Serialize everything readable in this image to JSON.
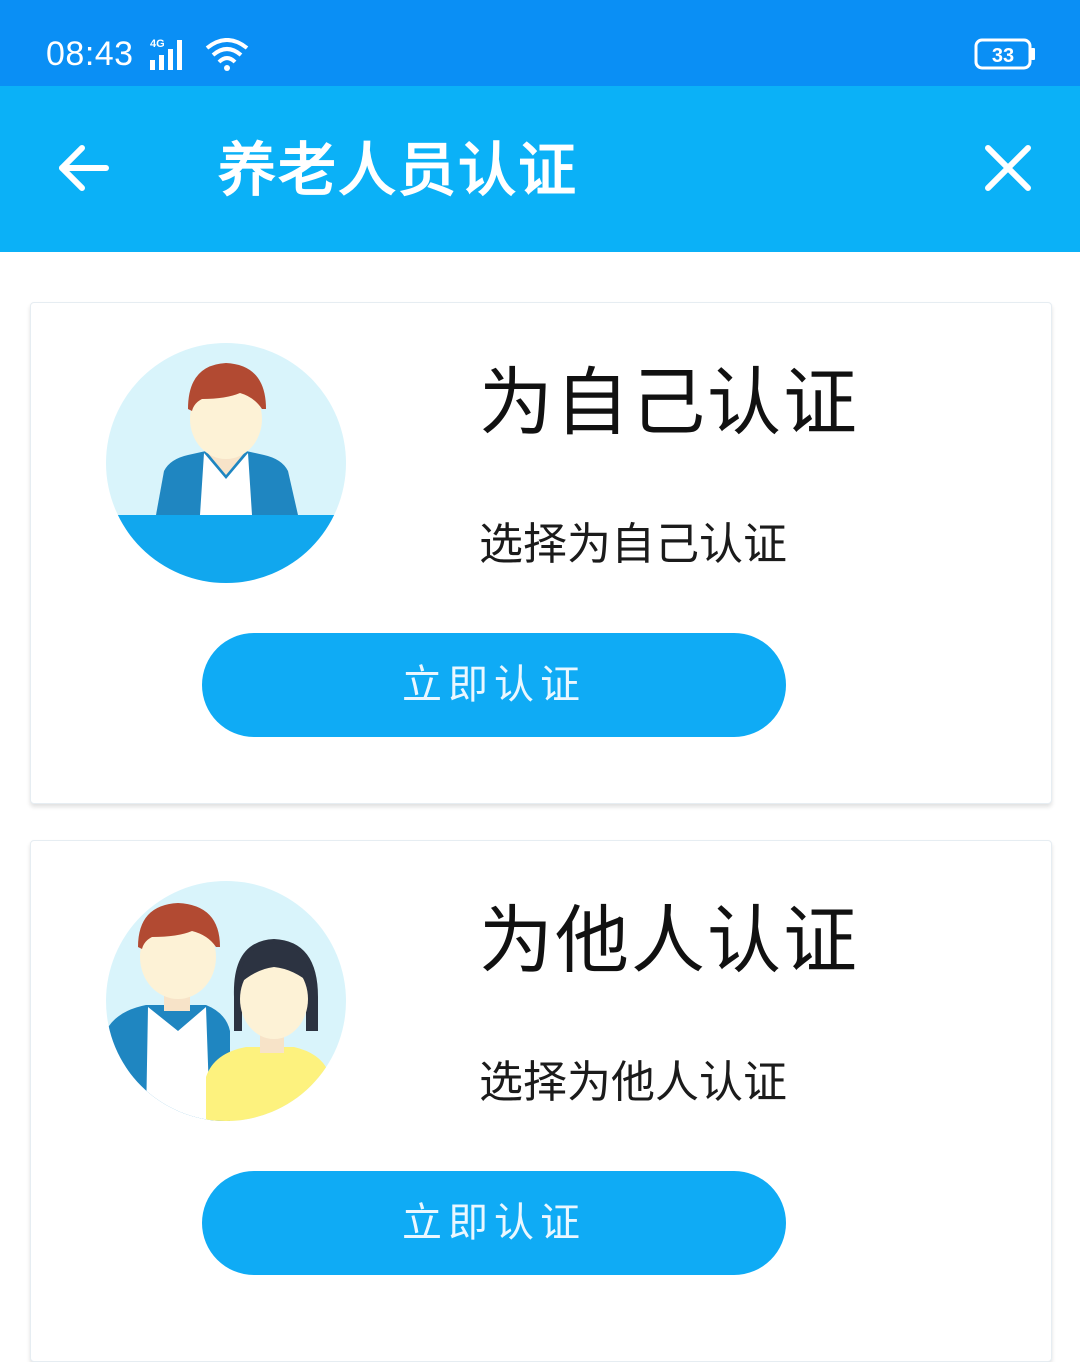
{
  "status_bar": {
    "time": "08:43",
    "network": "4G",
    "battery": "33"
  },
  "app_bar": {
    "title": "养老人员认证"
  },
  "cards": [
    {
      "title": "为自己认证",
      "subtitle": "选择为自己认证",
      "button_label": "立即认证",
      "avatar_icon": "single-person-icon"
    },
    {
      "title": "为他人认证",
      "subtitle": "选择为他人认证",
      "button_label": "立即认证",
      "avatar_icon": "two-persons-icon"
    }
  ],
  "colors": {
    "status_bar": "#0a8ff5",
    "app_bar": "#0bb1f7",
    "button": "#0fabf5"
  }
}
